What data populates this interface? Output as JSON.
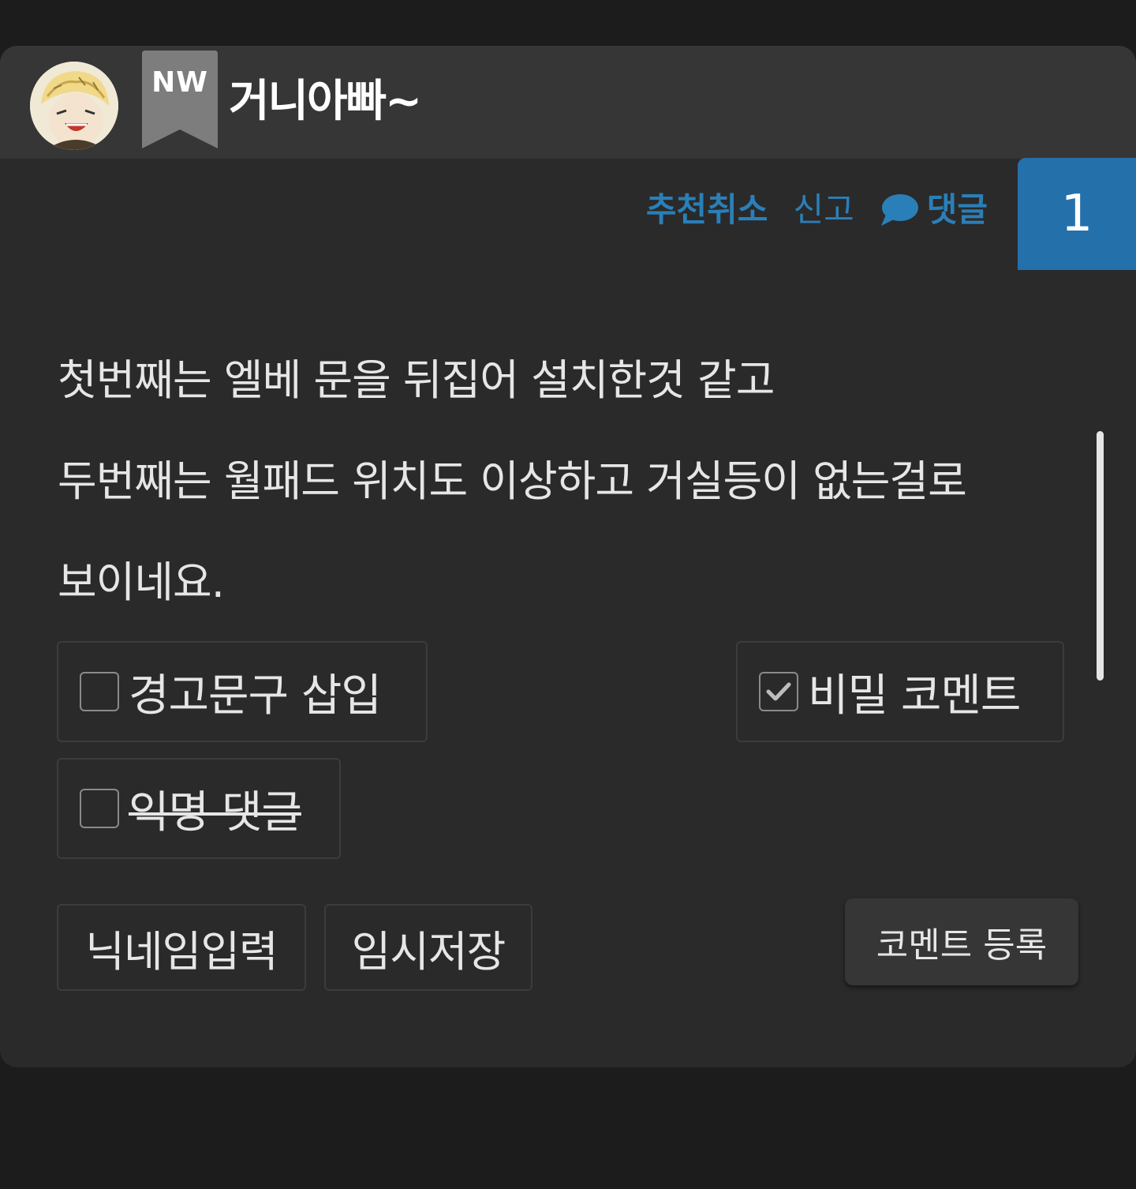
{
  "header": {
    "badge": "NW",
    "nickname": "거니아빠~"
  },
  "actions": {
    "recommend_cancel": "추천취소",
    "report": "신고",
    "reply": "댓글",
    "count": "1"
  },
  "comment": {
    "lines": [
      "첫번째는 엘베 문을 뒤집어 설치한것 같고",
      "두번째는 월패드 위치도 이상하고 거실등이 없는걸로",
      "보이네요."
    ]
  },
  "options": {
    "warning_insert": {
      "label": "경고문구 삽입",
      "checked": false
    },
    "secret_comment": {
      "label": "비밀 코멘트",
      "checked": true
    },
    "anonymous_reply": {
      "label": "익명 댓글",
      "checked": false,
      "disabled": true
    }
  },
  "buttons": {
    "nickname_input": "닉네임입력",
    "temp_save": "임시저장",
    "submit": "코멘트 등록"
  },
  "colors": {
    "accent": "#2a7fb8",
    "count_box": "#2470ab",
    "card_bg": "#2a2a2a",
    "header_bg": "#363636"
  }
}
